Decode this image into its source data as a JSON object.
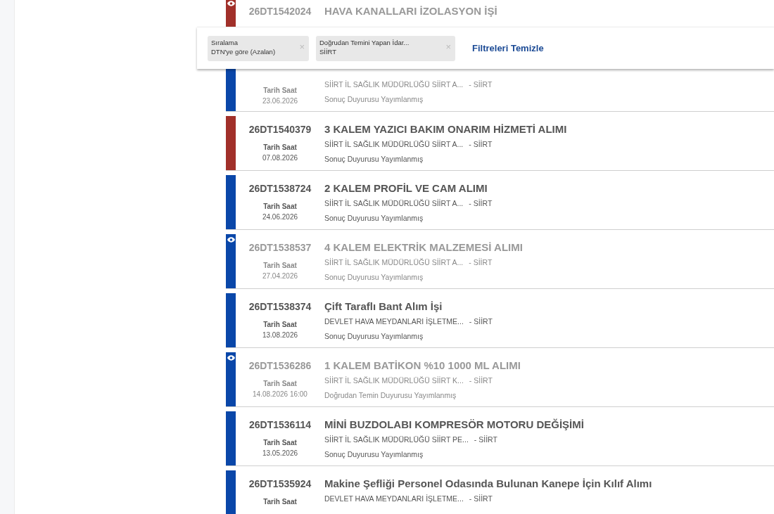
{
  "filters": [
    {
      "label": "Sıralama",
      "value": "DTN'ye göre (Azalan)",
      "remove": "×"
    },
    {
      "label": "Doğrudan Temini Yapan İdar...",
      "value": "SİİRT",
      "remove": "×"
    }
  ],
  "clear_filters": "Filtreleri Temizle",
  "results": [
    {
      "id": "26DT1542024",
      "title": "HAVA KANALLARI İZOLASYON İŞİ",
      "viewed": true,
      "color": "#a1302a"
    },
    {
      "org": "SİİRT İL SAĞLIK MÜDÜRLÜĞÜ SİİRT A...",
      "city": "- SİİRT",
      "date_label": "Tarih Saat",
      "date": "23.06.2026",
      "status": "Sonuç Duyurusu Yayımlanmış",
      "viewed": true,
      "color": "#0a47a9"
    },
    {
      "id": "26DT1540379",
      "title": "3 KALEM YAZICI BAKIM ONARIM HİZMETİ ALIMI",
      "org": "SİİRT İL SAĞLIK MÜDÜRLÜĞÜ SİİRT A...",
      "city": "- SİİRT",
      "date_label": "Tarih Saat",
      "date": "07.08.2026",
      "status": "Sonuç Duyurusu Yayımlanmış",
      "viewed": false,
      "color": "#a1302a"
    },
    {
      "id": "26DT1538724",
      "title": "2 KALEM PROFİL VE CAM ALIMI",
      "org": "SİİRT İL SAĞLIK MÜDÜRLÜĞÜ SİİRT A...",
      "city": "- SİİRT",
      "date_label": "Tarih Saat",
      "date": "24.06.2026",
      "status": "Sonuç Duyurusu Yayımlanmış",
      "viewed": false,
      "color": "#0a47a9"
    },
    {
      "id": "26DT1538537",
      "title": "4 KALEM ELEKTRİK MALZEMESİ ALIMI",
      "org": "SİİRT İL SAĞLIK MÜDÜRLÜĞÜ SİİRT A...",
      "city": "- SİİRT",
      "date_label": "Tarih Saat",
      "date": "27.04.2026",
      "status": "Sonuç Duyurusu Yayımlanmış",
      "viewed": true,
      "color": "#0a47a9"
    },
    {
      "id": "26DT1538374",
      "title": "Çift Taraflı Bant Alım İşi",
      "org": "DEVLET HAVA MEYDANLARI İŞLETME...",
      "city": "- SİİRT",
      "date_label": "Tarih Saat",
      "date": "13.08.2026",
      "status": "Sonuç Duyurusu Yayımlanmış",
      "viewed": false,
      "color": "#0a47a9"
    },
    {
      "id": "26DT1536286",
      "title": "1 KALEM BATİKON %10 1000 ML ALIMI",
      "org": "SİİRT İL SAĞLIK MÜDÜRLÜĞÜ SİİRT K...",
      "city": "- SİİRT",
      "date_label": "Tarih Saat",
      "date": "14.08.2026 16:00",
      "status": "Doğrudan Temin Duyurusu Yayımlanmış",
      "viewed": true,
      "color": "#0a47a9"
    },
    {
      "id": "26DT1536114",
      "title": "MİNİ BUZDOLABI KOMPRESÖR MOTORU DEĞİŞİMİ",
      "org": "SİİRT İL SAĞLIK MÜDÜRLÜĞÜ SİİRT PE...",
      "city": "- SİİRT",
      "date_label": "Tarih Saat",
      "date": "13.05.2026",
      "status": "Sonuç Duyurusu Yayımlanmış",
      "viewed": false,
      "color": "#0a47a9"
    },
    {
      "id": "26DT1535924",
      "title": "Makine Şefliği Personel Odasında Bulunan Kanepe İçin Kılıf Alımı",
      "org": "DEVLET HAVA MEYDANLARI İŞLETME...",
      "city": "- SİİRT",
      "date_label": "Tarih Saat",
      "viewed": false,
      "color": "#0a47a9"
    }
  ]
}
